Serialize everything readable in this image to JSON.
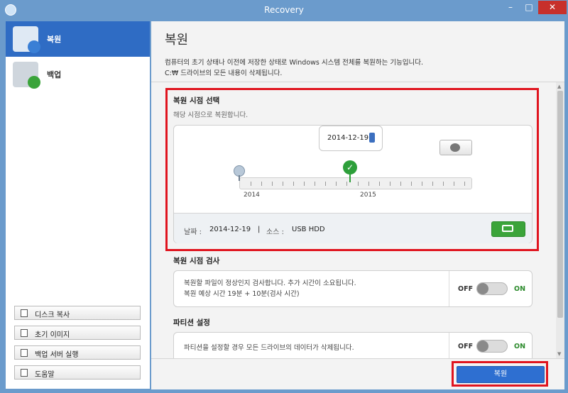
{
  "window": {
    "title": "Recovery",
    "minimize_glyph": "–",
    "maximize_glyph": "□",
    "close_glyph": "✕"
  },
  "sidebar": {
    "nav": [
      {
        "label": "복원",
        "icon": "restore-drive-icon",
        "active": true
      },
      {
        "label": "백업",
        "icon": "backup-drive-icon",
        "active": false
      }
    ],
    "tools": [
      {
        "label": "디스크 복사",
        "icon": "disk-copy-icon"
      },
      {
        "label": "초기 이미지",
        "icon": "initial-image-icon"
      },
      {
        "label": "백업 서버 실행",
        "icon": "backup-server-icon"
      },
      {
        "label": "도움말",
        "icon": "help-icon"
      }
    ]
  },
  "main": {
    "title": "복원",
    "description_line1": "컴퓨터의 초기 상태나 이전에 저장한 상태로 Windows 시스템 전체를 복원하는 기능입니다.",
    "description_line2": "C:₩ 드라이브의 모든 내용이 삭제됩니다.",
    "restore_point": {
      "title": "복원 시점 선택",
      "subtitle": "해당 시점으로 복원합니다.",
      "selected_date": "2014-12-19",
      "year_labels": [
        "2014",
        "2015"
      ],
      "info": {
        "date_label": "날짜 :",
        "date_value": "2014-12-19",
        "separator": "|",
        "source_label": "소스 :",
        "source_value": "USB HDD"
      }
    },
    "check": {
      "title": "복원 시점 검사",
      "line1": "복원할 파일이 정상인지 검사합니다. 추가 시간이 소요됩니다.",
      "line2": "복원 예상 시간 19분 + 10분(검사 시간)",
      "off_label": "OFF",
      "on_label": "ON",
      "state": "off"
    },
    "partition": {
      "title": "파티션 설정",
      "line1": "파티션을 설정할 경우 모든 드라이브의 데이터가 삭제됩니다.",
      "off_label": "OFF",
      "on_label": "ON",
      "state": "off"
    },
    "restore_button": "복원"
  },
  "colors": {
    "accent": "#2e6fd1",
    "highlight": "#e0141e",
    "success": "#2d9f3a"
  }
}
